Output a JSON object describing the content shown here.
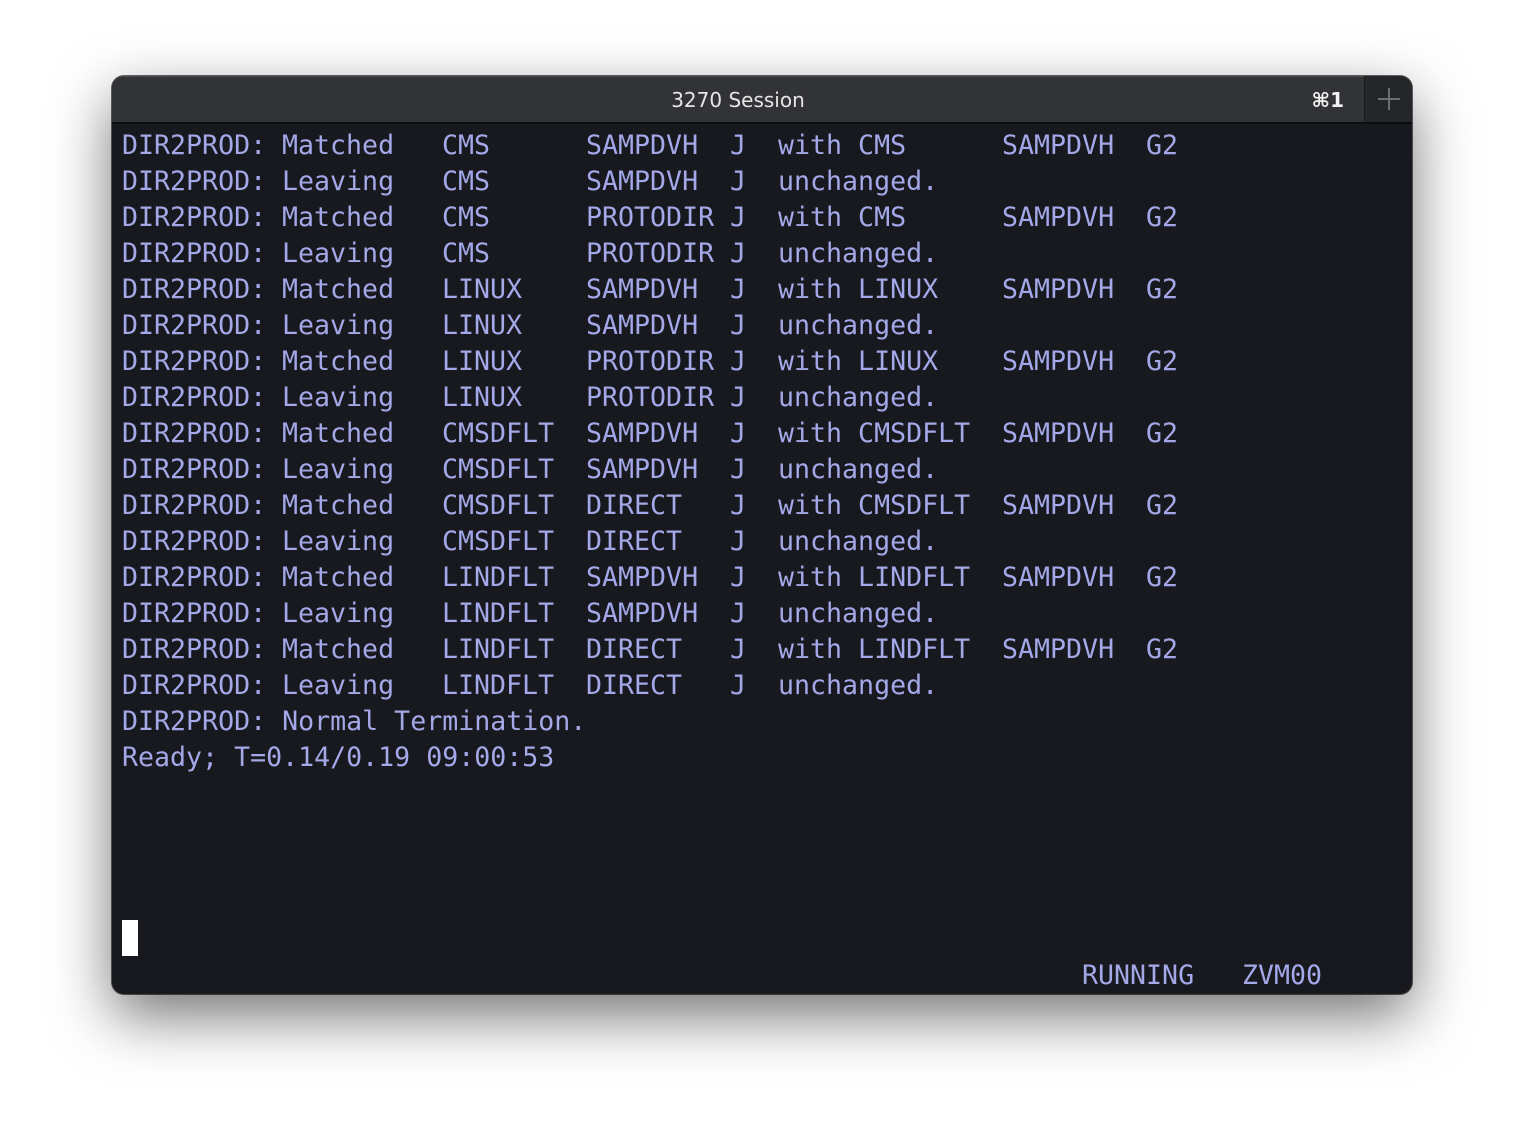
{
  "window": {
    "title": "3270 Session",
    "shortcut": "⌘1",
    "new_tab_icon": "plus-icon"
  },
  "terminal": {
    "rows": [
      {
        "prog": "DIR2PROD:",
        "action": "Matched",
        "user": "CMS",
        "dir": "SAMPDVH",
        "flag": "J",
        "rest": "with CMS",
        "target": "SAMPDVH",
        "code": "G2"
      },
      {
        "prog": "DIR2PROD:",
        "action": "Leaving",
        "user": "CMS",
        "dir": "SAMPDVH",
        "flag": "J",
        "rest": "unchanged.",
        "target": "",
        "code": ""
      },
      {
        "prog": "DIR2PROD:",
        "action": "Matched",
        "user": "CMS",
        "dir": "PROTODIR",
        "flag": "J",
        "rest": "with CMS",
        "target": "SAMPDVH",
        "code": "G2"
      },
      {
        "prog": "DIR2PROD:",
        "action": "Leaving",
        "user": "CMS",
        "dir": "PROTODIR",
        "flag": "J",
        "rest": "unchanged.",
        "target": "",
        "code": ""
      },
      {
        "prog": "DIR2PROD:",
        "action": "Matched",
        "user": "LINUX",
        "dir": "SAMPDVH",
        "flag": "J",
        "rest": "with LINUX",
        "target": "SAMPDVH",
        "code": "G2"
      },
      {
        "prog": "DIR2PROD:",
        "action": "Leaving",
        "user": "LINUX",
        "dir": "SAMPDVH",
        "flag": "J",
        "rest": "unchanged.",
        "target": "",
        "code": ""
      },
      {
        "prog": "DIR2PROD:",
        "action": "Matched",
        "user": "LINUX",
        "dir": "PROTODIR",
        "flag": "J",
        "rest": "with LINUX",
        "target": "SAMPDVH",
        "code": "G2"
      },
      {
        "prog": "DIR2PROD:",
        "action": "Leaving",
        "user": "LINUX",
        "dir": "PROTODIR",
        "flag": "J",
        "rest": "unchanged.",
        "target": "",
        "code": ""
      },
      {
        "prog": "DIR2PROD:",
        "action": "Matched",
        "user": "CMSDFLT",
        "dir": "SAMPDVH",
        "flag": "J",
        "rest": "with CMSDFLT",
        "target": "SAMPDVH",
        "code": "G2"
      },
      {
        "prog": "DIR2PROD:",
        "action": "Leaving",
        "user": "CMSDFLT",
        "dir": "SAMPDVH",
        "flag": "J",
        "rest": "unchanged.",
        "target": "",
        "code": ""
      },
      {
        "prog": "DIR2PROD:",
        "action": "Matched",
        "user": "CMSDFLT",
        "dir": "DIRECT",
        "flag": "J",
        "rest": "with CMSDFLT",
        "target": "SAMPDVH",
        "code": "G2"
      },
      {
        "prog": "DIR2PROD:",
        "action": "Leaving",
        "user": "CMSDFLT",
        "dir": "DIRECT",
        "flag": "J",
        "rest": "unchanged.",
        "target": "",
        "code": ""
      },
      {
        "prog": "DIR2PROD:",
        "action": "Matched",
        "user": "LINDFLT",
        "dir": "SAMPDVH",
        "flag": "J",
        "rest": "with LINDFLT",
        "target": "SAMPDVH",
        "code": "G2"
      },
      {
        "prog": "DIR2PROD:",
        "action": "Leaving",
        "user": "LINDFLT",
        "dir": "SAMPDVH",
        "flag": "J",
        "rest": "unchanged.",
        "target": "",
        "code": ""
      },
      {
        "prog": "DIR2PROD:",
        "action": "Matched",
        "user": "LINDFLT",
        "dir": "DIRECT",
        "flag": "J",
        "rest": "with LINDFLT",
        "target": "SAMPDVH",
        "code": "G2"
      },
      {
        "prog": "DIR2PROD:",
        "action": "Leaving",
        "user": "LINDFLT",
        "dir": "DIRECT",
        "flag": "J",
        "rest": "unchanged.",
        "target": "",
        "code": ""
      }
    ],
    "termination_line": "DIR2PROD: Normal Termination.",
    "ready_line": "Ready; T=0.14/0.19 09:00:53",
    "status_state": "RUNNING",
    "status_system": "ZVM00"
  },
  "colors": {
    "text": "#a4a8e8",
    "background": "#17191e",
    "titlebar": "#323336",
    "cursor": "#ffffff"
  }
}
